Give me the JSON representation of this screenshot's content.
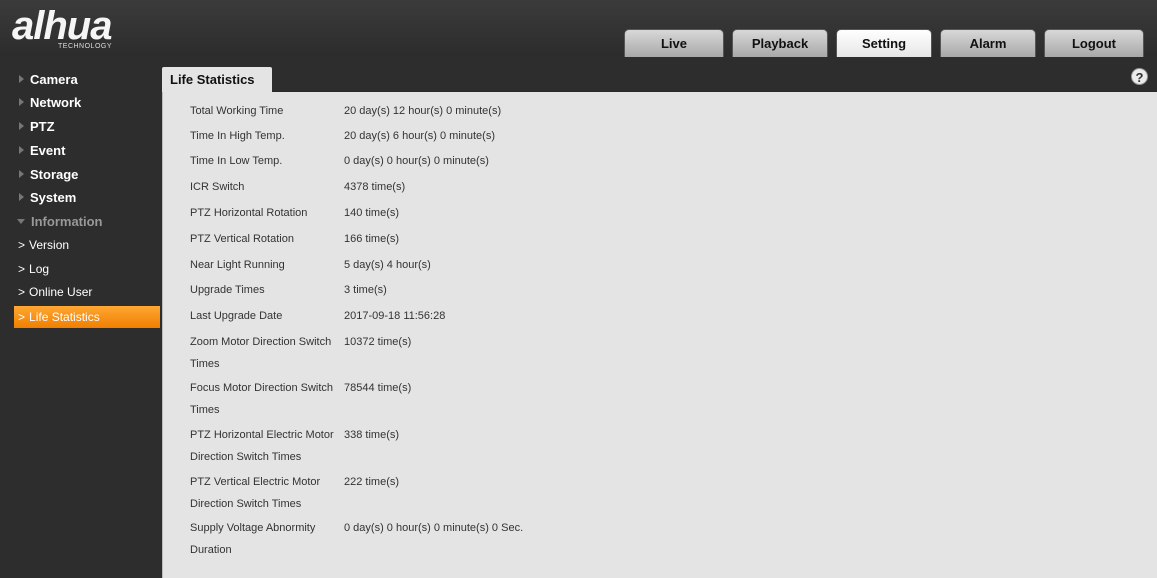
{
  "brand": {
    "logo_text": "alhua",
    "logo_sub": "TECHNOLOGY"
  },
  "top_tabs": [
    {
      "label": "Live"
    },
    {
      "label": "Playback"
    },
    {
      "label": "Setting"
    },
    {
      "label": "Alarm"
    },
    {
      "label": "Logout"
    }
  ],
  "sidebar": {
    "categories": [
      {
        "label": "Camera"
      },
      {
        "label": "Network"
      },
      {
        "label": "PTZ"
      },
      {
        "label": "Event"
      },
      {
        "label": "Storage"
      },
      {
        "label": "System"
      },
      {
        "label": "Information"
      }
    ],
    "sub_items": [
      {
        "label": "Version"
      },
      {
        "label": "Log"
      },
      {
        "label": "Online User"
      },
      {
        "label": "Life Statistics"
      }
    ]
  },
  "panel": {
    "title": "Life Statistics",
    "help": "?",
    "rows": [
      {
        "label": "Total Working Time",
        "value": "20 day(s) 12 hour(s) 0 minute(s)"
      },
      {
        "label": "Time In High Temp.",
        "value": "20 day(s) 6 hour(s) 0 minute(s)"
      },
      {
        "label": "Time In Low Temp.",
        "value": "0 day(s) 0 hour(s) 0 minute(s)"
      },
      {
        "label": "ICR Switch",
        "value": "4378 time(s)"
      },
      {
        "label": "PTZ Horizontal Rotation",
        "value": "140 time(s)"
      },
      {
        "label": "PTZ Vertical Rotation",
        "value": "166 time(s)"
      },
      {
        "label": "Near Light Running",
        "value": "5 day(s) 4 hour(s)"
      },
      {
        "label": "Upgrade Times",
        "value": "3 time(s)"
      },
      {
        "label": "Last Upgrade Date",
        "value": "2017-09-18 11:56:28"
      },
      {
        "label1": "Zoom Motor Direction Switch",
        "label2": "Times",
        "value": "10372 time(s)"
      },
      {
        "label1": "Focus Motor Direction Switch",
        "label2": "Times",
        "value": "78544 time(s)"
      },
      {
        "label1": "PTZ Horizontal Electric Motor",
        "label2": "Direction Switch Times",
        "value": "338 time(s)"
      },
      {
        "label1": "PTZ Vertical Electric Motor",
        "label2": "Direction Switch Times",
        "value": "222 time(s)"
      },
      {
        "label1": "Supply Voltage Abnormity",
        "label2": "Duration",
        "value": "0 day(s) 0 hour(s) 0 minute(s) 0 Sec."
      }
    ]
  }
}
